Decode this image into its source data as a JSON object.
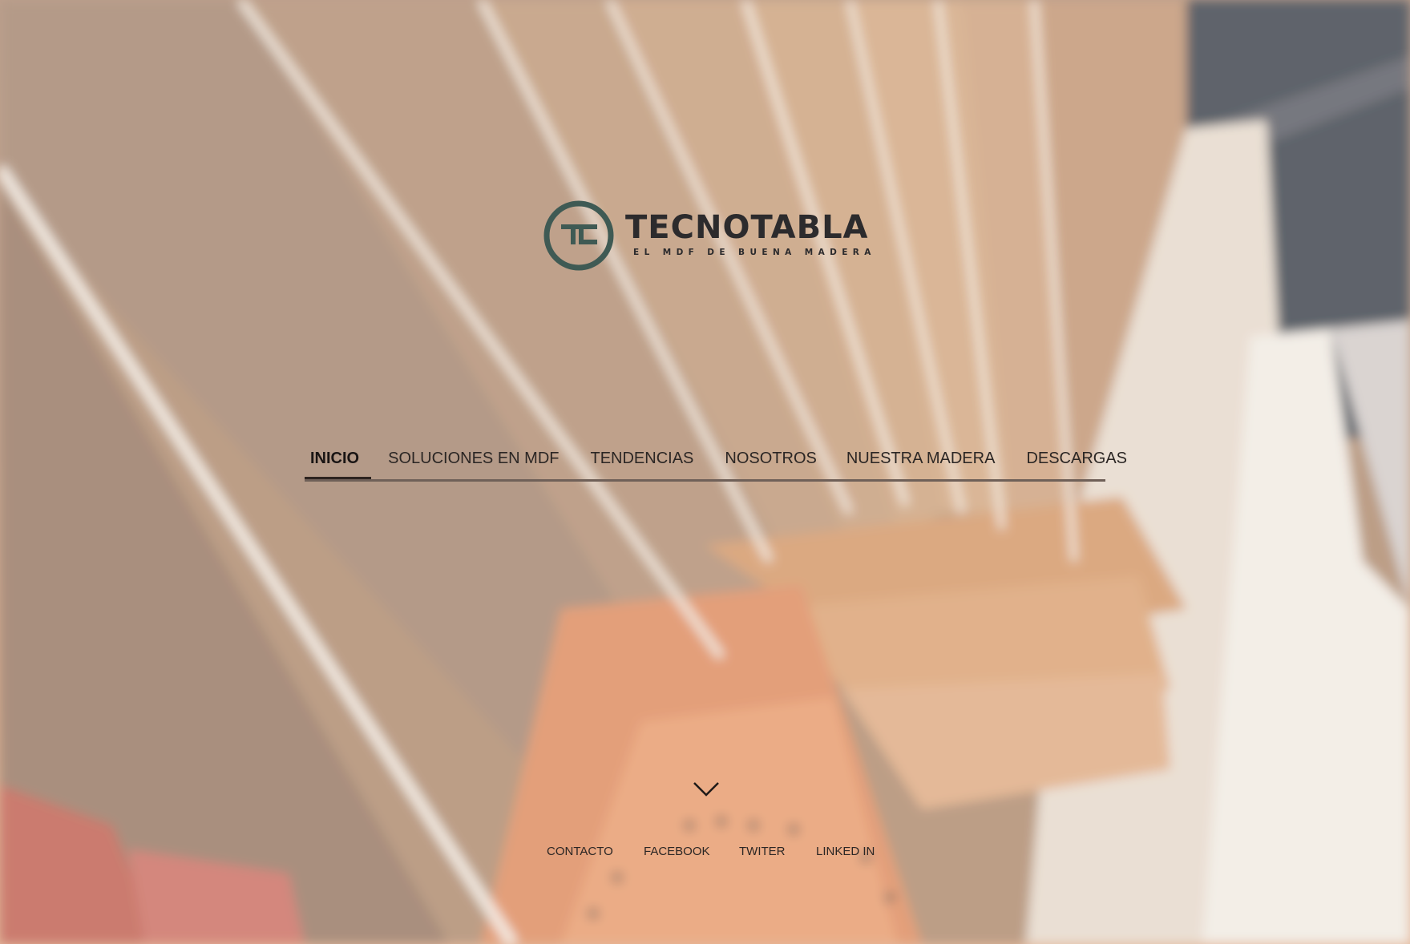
{
  "brand": {
    "name": "TECNOTABLA",
    "tagline": "EL MDF DE BUENA MADERA",
    "mark_icon": "tecnotabla-circle-logo-icon",
    "mark_color": "#3f5a54",
    "text_color": "#2c2b2d"
  },
  "nav": {
    "items": [
      {
        "label": "INICIO",
        "active": true
      },
      {
        "label": "SOLUCIONES EN MDF",
        "active": false
      },
      {
        "label": "TENDENCIAS",
        "active": false
      },
      {
        "label": "NOSOTROS",
        "active": false
      },
      {
        "label": "NUESTRA MADERA",
        "active": false
      },
      {
        "label": "DESCARGAS",
        "active": false
      }
    ]
  },
  "scroll": {
    "icon": "chevron-down-icon"
  },
  "footer": {
    "links": [
      {
        "label": "CONTACTO"
      },
      {
        "label": "FACEBOOK"
      },
      {
        "label": "TWITER"
      },
      {
        "label": "LINKED IN"
      }
    ]
  },
  "background": {
    "description_icon": "blurred-mdf-boards-background",
    "tone": "#c4a289"
  }
}
